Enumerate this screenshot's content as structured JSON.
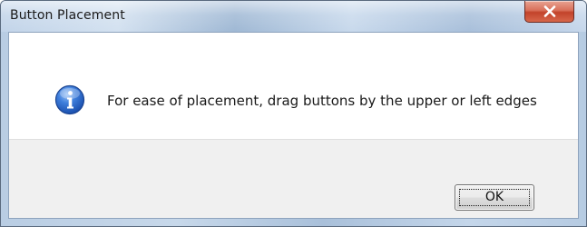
{
  "dialog": {
    "title": "Button Placement",
    "message": "For ease of placement, drag buttons by the upper or left edges",
    "ok_label": "OK",
    "icon": "info-icon"
  },
  "colors": {
    "close_button": "#c94a32",
    "info_icon": "#2a62c9"
  }
}
